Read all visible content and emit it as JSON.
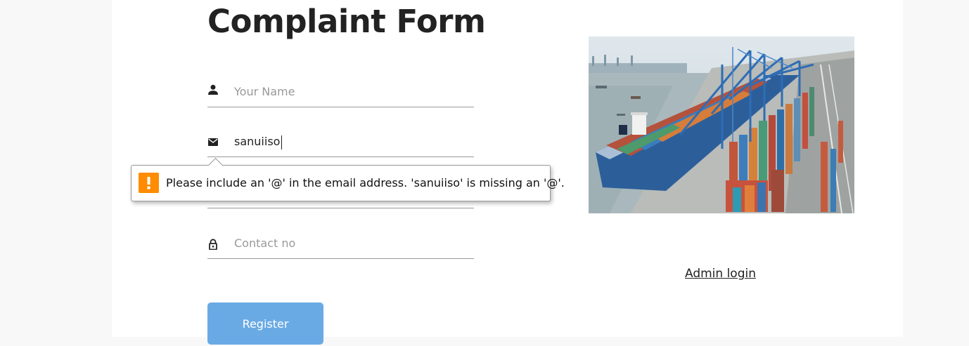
{
  "form": {
    "title": "Complaint Form",
    "name_placeholder": "Your Name",
    "email_value": "sanuiiso",
    "contact_placeholder": "Contact no",
    "register_label": "Register",
    "icons": {
      "name": "person-icon",
      "email": "mail-icon",
      "contact": "lock-icon"
    }
  },
  "validation": {
    "message": "Please include an '@' in the email address. 'sanuiiso' is missing an '@'.",
    "icon": "warning-icon",
    "icon_color": "#ff8c00"
  },
  "sidebar": {
    "image": "container-port-photo",
    "admin_link": "Admin login"
  },
  "colors": {
    "button": "#6aaae4",
    "background": "#f8f8f8",
    "card": "#ffffff"
  }
}
